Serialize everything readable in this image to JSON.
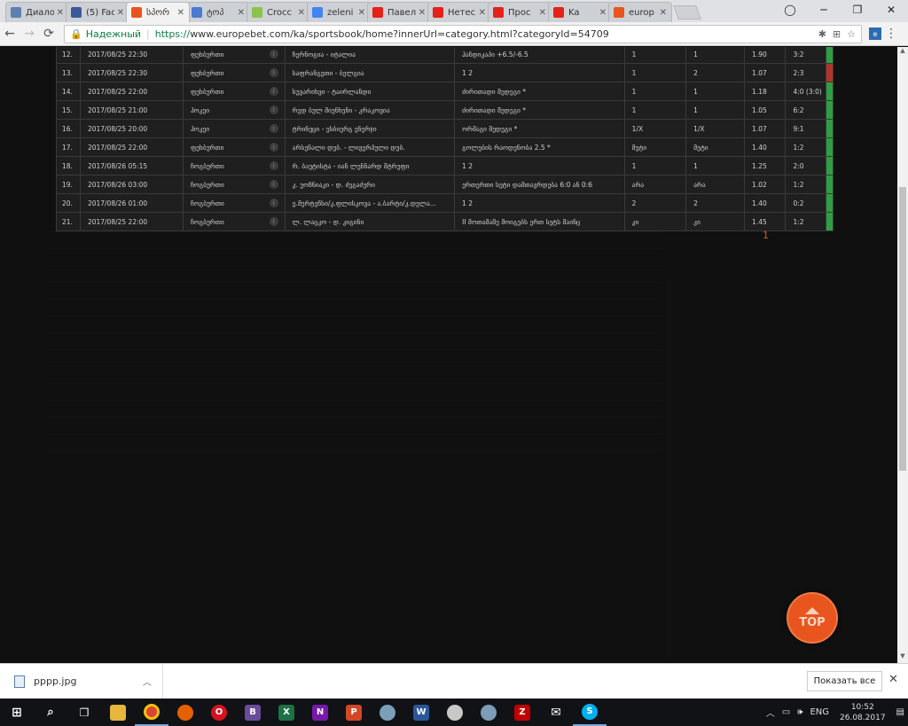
{
  "browser": {
    "tabs": [
      {
        "title": "Диало",
        "favicon": "vk-icon",
        "color": "#5b80b2",
        "active": false
      },
      {
        "title": "(5) Fac",
        "favicon": "facebook-icon",
        "color": "#3b5998",
        "active": false
      },
      {
        "title": "სპორ",
        "favicon": "europebet-icon",
        "color": "#e8551e",
        "active": true
      },
      {
        "title": "ტოპ",
        "favicon": "pet-icon",
        "color": "#4a7bd1",
        "active": false
      },
      {
        "title": "Crocc",
        "favicon": "croc-icon",
        "color": "#8bc34a",
        "active": false
      },
      {
        "title": "zeleni",
        "favicon": "google-icon",
        "color": "#4285f4",
        "active": false
      },
      {
        "title": "Павел",
        "favicon": "youtube-icon",
        "color": "#e62117",
        "active": false
      },
      {
        "title": "Нетес",
        "favicon": "youtube-icon",
        "color": "#e62117",
        "active": false
      },
      {
        "title": "Прос",
        "favicon": "youtube-icon",
        "color": "#e62117",
        "active": false
      },
      {
        "title": "Ka",
        "favicon": "youtube-icon",
        "color": "#e62117",
        "active": false
      },
      {
        "title": "europ",
        "favicon": "europebet-icon",
        "color": "#e8551e",
        "active": false
      }
    ],
    "secure_label": "Надежный",
    "url_scheme": "https://",
    "url_rest": "www.europebet.com/ka/sportsbook/home?innerUrl=category.html?categoryId=54709"
  },
  "bets": [
    {
      "num": "12.",
      "date": "2017/08/25 22:30",
      "sport": "ფეხბურთი",
      "match": "ჩერნოგია - იტალია",
      "market": "ჰანდიკაპი +6.5/-6.5",
      "pick": "1",
      "result": "1",
      "odds": "1.90",
      "score": "3:2",
      "status": "green"
    },
    {
      "num": "13.",
      "date": "2017/08/25 22:30",
      "sport": "ფეხბურთი",
      "match": "საფრანგეთი - ბელგია",
      "market": "1 2",
      "pick": "1",
      "result": "2",
      "odds": "1.07",
      "score": "2:3",
      "status": "red"
    },
    {
      "num": "14.",
      "date": "2017/08/25 22:00",
      "sport": "ფეხბურთი",
      "match": "სუვარიხვი - ტაირლანდი",
      "market": "ძირითადი შედეგი *",
      "pick": "1",
      "result": "1",
      "odds": "1.18",
      "score": "4:0 (3:0)",
      "status": "green"
    },
    {
      "num": "15.",
      "date": "2017/08/25 21:00",
      "sport": "ჰოკეი",
      "match": "რედ ბულ მიუნხენი - კრაკოვია",
      "market": "ძირითადი შედეგი *",
      "pick": "1",
      "result": "1",
      "odds": "1.05",
      "score": "6:2",
      "status": "green"
    },
    {
      "num": "16.",
      "date": "2017/08/25 20:00",
      "sport": "ჰოკეი",
      "match": "ტრინეცი - ესბიერგ ენერჯი",
      "market": "ორმაგი შედეგი *",
      "pick": "1/X",
      "result": "1/X",
      "odds": "1.07",
      "score": "9:1",
      "status": "green"
    },
    {
      "num": "17.",
      "date": "2017/08/25 22:00",
      "sport": "ფეხბურთი",
      "match": "არსენალი დუბ. - ლივერპული დუბ.",
      "market": "გოლების რაოდენობა 2.5 *",
      "pick": "მეტი",
      "result": "მეტი",
      "odds": "1.40",
      "score": "1:2",
      "status": "green"
    },
    {
      "num": "18.",
      "date": "2017/08/26 05:15",
      "sport": "ჩოგბურთი",
      "match": "რ. ბაუტისტა - იან ლენნარდ შტრუფი",
      "market": "1 2",
      "pick": "1",
      "result": "1",
      "odds": "1.25",
      "score": "2:0",
      "status": "green"
    },
    {
      "num": "19.",
      "date": "2017/08/26 03:00",
      "sport": "ჩოგბურთი",
      "match": "კ. უოზნიაკი - დ. ძეგაძერი",
      "market": "ერთერთი სეტი დამთავრდება 6:0 ან 0:6",
      "pick": "არა",
      "result": "არა",
      "odds": "1.02",
      "score": "1:2",
      "status": "green"
    },
    {
      "num": "20.",
      "date": "2017/08/26 01:00",
      "sport": "ჩოგბურთი",
      "match": "ე.მერტენსი/კ.ფლისკოვა - ა.ბარტი/კ.დელა...",
      "market": "1 2",
      "pick": "2",
      "result": "2",
      "odds": "1.40",
      "score": "0:2",
      "status": "green"
    },
    {
      "num": "21.",
      "date": "2017/08/25 22:00",
      "sport": "ჩოგბურთი",
      "match": "ლ. ლაცკო - დ. კიგინი",
      "market": "II მოთამაშე მოიგებს ერთ სეტს მაინც",
      "pick": "კი",
      "result": "კი",
      "odds": "1.45",
      "score": "1:2",
      "status": "green"
    }
  ],
  "pager": {
    "page": "1"
  },
  "top_button": {
    "label": "TOP"
  },
  "downloads": {
    "file": "pppp.jpg",
    "show_all": "Показать все"
  },
  "taskbar": {
    "lang": "ENG",
    "time": "10:52",
    "date": "26.08.2017"
  },
  "colors": {
    "accent": "#e8551e",
    "win": "#2e9e44",
    "loss": "#b3322c"
  }
}
